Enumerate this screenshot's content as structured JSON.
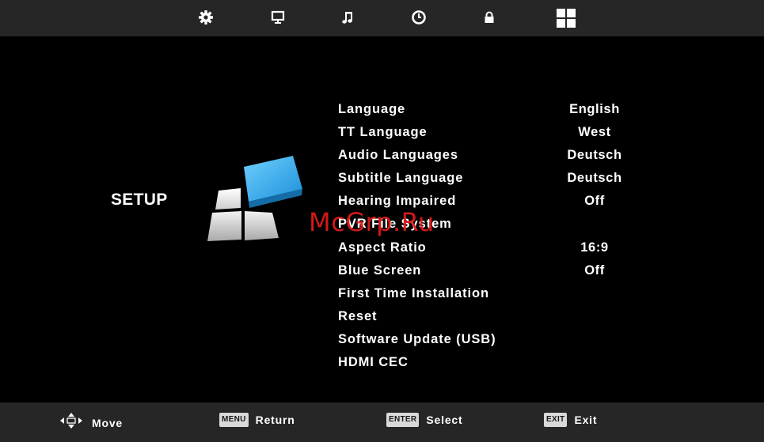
{
  "top_nav": {
    "icons": [
      "gear-icon",
      "monitor-icon",
      "music-note-icon",
      "clock-icon",
      "lock-icon",
      "setup-grid-icon"
    ],
    "active": "setup-grid-icon"
  },
  "page": {
    "title": "SETUP"
  },
  "menu": {
    "items": [
      {
        "label": "Language",
        "value": "English"
      },
      {
        "label": "TT Language",
        "value": "West"
      },
      {
        "label": "Audio Languages",
        "value": "Deutsch"
      },
      {
        "label": "Subtitle Language",
        "value": "Deutsch"
      },
      {
        "label": "Hearing Impaired",
        "value": "Off"
      },
      {
        "label": "PVR File System",
        "value": ""
      },
      {
        "label": "Aspect Ratio",
        "value": "16:9"
      },
      {
        "label": "Blue Screen",
        "value": "Off"
      },
      {
        "label": "First Time Installation",
        "value": ""
      },
      {
        "label": "Reset",
        "value": ""
      },
      {
        "label": "Software Update (USB)",
        "value": ""
      },
      {
        "label": "HDMI CEC",
        "value": ""
      }
    ]
  },
  "footer": {
    "move": {
      "icon": "arrows-icon",
      "label": "Move"
    },
    "return": {
      "key": "MENU",
      "label": "Return"
    },
    "select": {
      "key": "ENTER",
      "label": "Select"
    },
    "exit": {
      "key": "EXIT",
      "label": "Exit"
    }
  },
  "watermark": "McGrp.Ru",
  "colors": {
    "bar": "#262626",
    "background": "#000000",
    "accent_blue": "#2aa3e6",
    "watermark": "#e31b1b"
  }
}
